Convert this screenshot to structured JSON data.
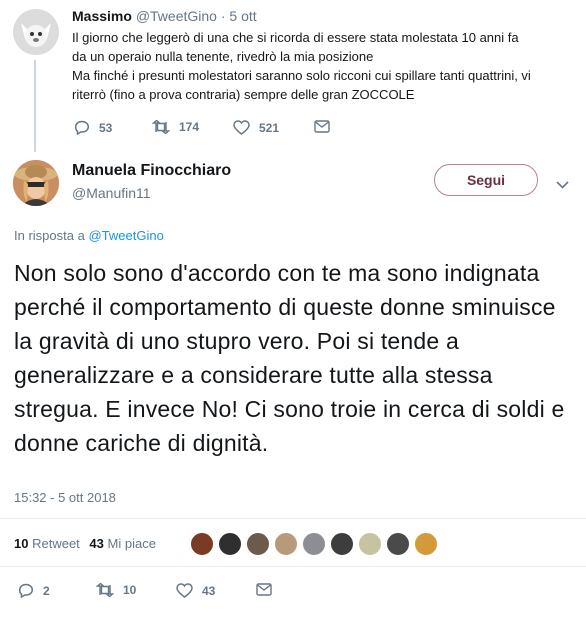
{
  "parent_tweet": {
    "display_name": "Massimo",
    "handle": "@TweetGino",
    "time": "· 5 ott",
    "lines": [
      "Il giorno che leggerò di una che si ricorda di essere stata molestata 10 anni fa",
      "da un operaio nulla tenente, rivedrò la mia posizione",
      "Ma finché i presunti molestatori saranno solo ricconi cui spillare tanti quattrini, vi",
      "riterrò (fino a prova contraria) sempre delle gran ZOCCOLE"
    ],
    "replies": "53",
    "retweets": "174",
    "likes": "521"
  },
  "main_tweet": {
    "display_name": "Manuela Finocchiaro",
    "handle": "@Manufin11",
    "follow_label": "Segui",
    "reply_prefix": "In risposta a",
    "reply_to": "@TweetGino",
    "text": "Non solo sono d'accordo con te ma sono indignata perché il comportamento di queste donne sminuisce la gravità di uno stupro vero. Poi si tende a generalizzare e a considerare tutte alla stessa stregua. E invece No! Ci sono troie in cerca di soldi e donne cariche di dignità.",
    "timestamp": "15:32 - 5 ott 2018",
    "retweet_count": "10",
    "retweet_label": "Retweet",
    "like_count": "43",
    "like_label": "Mi piace",
    "replies": "2",
    "retweets": "10",
    "likes": "43"
  },
  "colors": {
    "link": "#1b95e0",
    "muted": "#657786",
    "follow_border": "#b5838a"
  }
}
